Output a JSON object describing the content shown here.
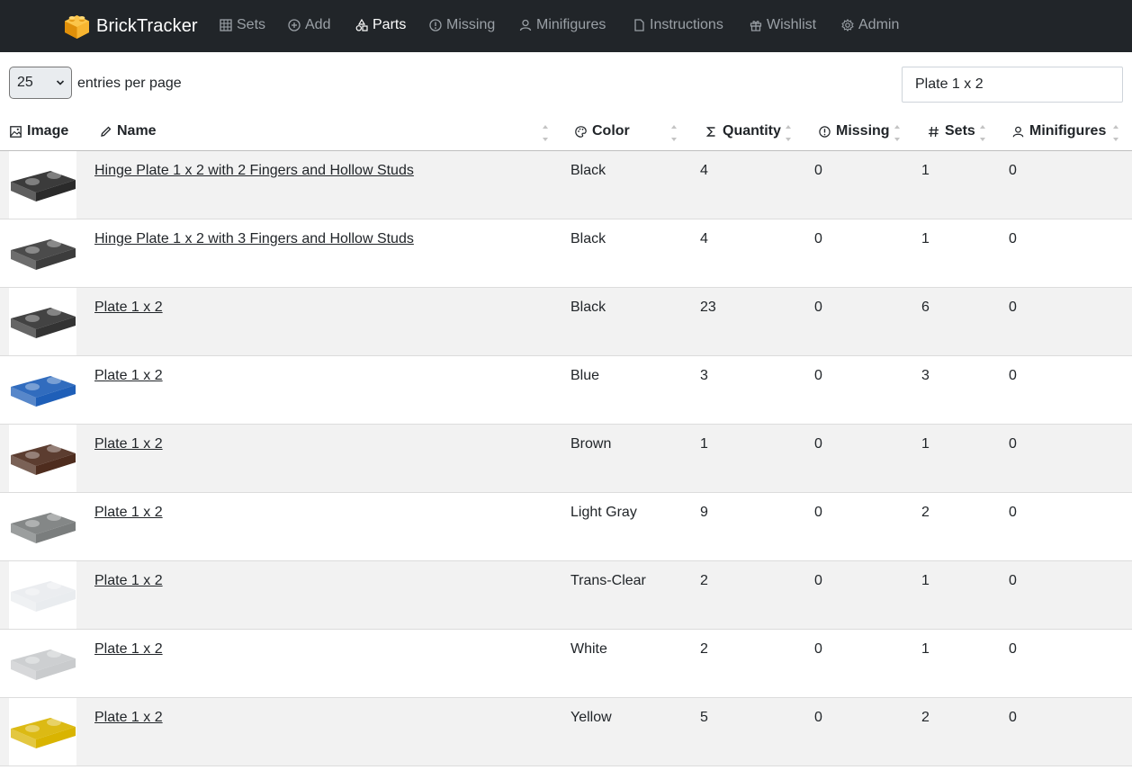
{
  "nav": {
    "brand": "BrickTracker",
    "items": [
      {
        "label": "Sets",
        "icon": "grid-icon"
      },
      {
        "label": "Add",
        "icon": "plus-circle-icon"
      },
      {
        "label": "Parts",
        "icon": "shapes-icon"
      },
      {
        "label": "Missing",
        "icon": "alert-circle-icon"
      },
      {
        "label": "Minifigures",
        "icon": "user-icon"
      },
      {
        "label": "Instructions",
        "icon": "file-icon"
      },
      {
        "label": "Wishlist",
        "icon": "gift-icon"
      },
      {
        "label": "Admin",
        "icon": "settings-icon"
      }
    ],
    "active": "Parts"
  },
  "controls": {
    "per_page_value": "25",
    "per_page_label": "entries per page",
    "search_value": "Plate 1 x 2"
  },
  "table": {
    "headers": {
      "image": "Image",
      "name": "Name",
      "color": "Color",
      "quantity": "Quantity",
      "missing": "Missing",
      "sets": "Sets",
      "minifigures": "Minifigures"
    },
    "rows": [
      {
        "name": "Hinge Plate 1 x 2 with 2 Fingers and Hollow Studs",
        "color": "Black",
        "quantity": "4",
        "missing": "0",
        "sets": "1",
        "minifigures": "0",
        "swatch": "#2a2a2a"
      },
      {
        "name": "Hinge Plate 1 x 2 with 3 Fingers and Hollow Studs",
        "color": "Black",
        "quantity": "4",
        "missing": "0",
        "sets": "1",
        "minifigures": "0",
        "swatch": "#3c3c3c"
      },
      {
        "name": "Plate 1 x 2",
        "color": "Black",
        "quantity": "23",
        "missing": "0",
        "sets": "6",
        "minifigures": "0",
        "swatch": "#333333"
      },
      {
        "name": "Plate 1 x 2",
        "color": "Blue",
        "quantity": "3",
        "missing": "0",
        "sets": "3",
        "minifigures": "0",
        "swatch": "#1f5fb8"
      },
      {
        "name": "Plate 1 x 2",
        "color": "Brown",
        "quantity": "1",
        "missing": "0",
        "sets": "1",
        "minifigures": "0",
        "swatch": "#4e2c1e"
      },
      {
        "name": "Plate 1 x 2",
        "color": "Light Gray",
        "quantity": "9",
        "missing": "0",
        "sets": "2",
        "minifigures": "0",
        "swatch": "#7a7d7d"
      },
      {
        "name": "Plate 1 x 2",
        "color": "Trans-Clear",
        "quantity": "2",
        "missing": "0",
        "sets": "1",
        "minifigures": "0",
        "swatch": "#e9ecef"
      },
      {
        "name": "Plate 1 x 2",
        "color": "White",
        "quantity": "2",
        "missing": "0",
        "sets": "1",
        "minifigures": "0",
        "swatch": "#c9cbcd"
      },
      {
        "name": "Plate 1 x 2",
        "color": "Yellow",
        "quantity": "5",
        "missing": "0",
        "sets": "2",
        "minifigures": "0",
        "swatch": "#d9b400"
      }
    ]
  }
}
